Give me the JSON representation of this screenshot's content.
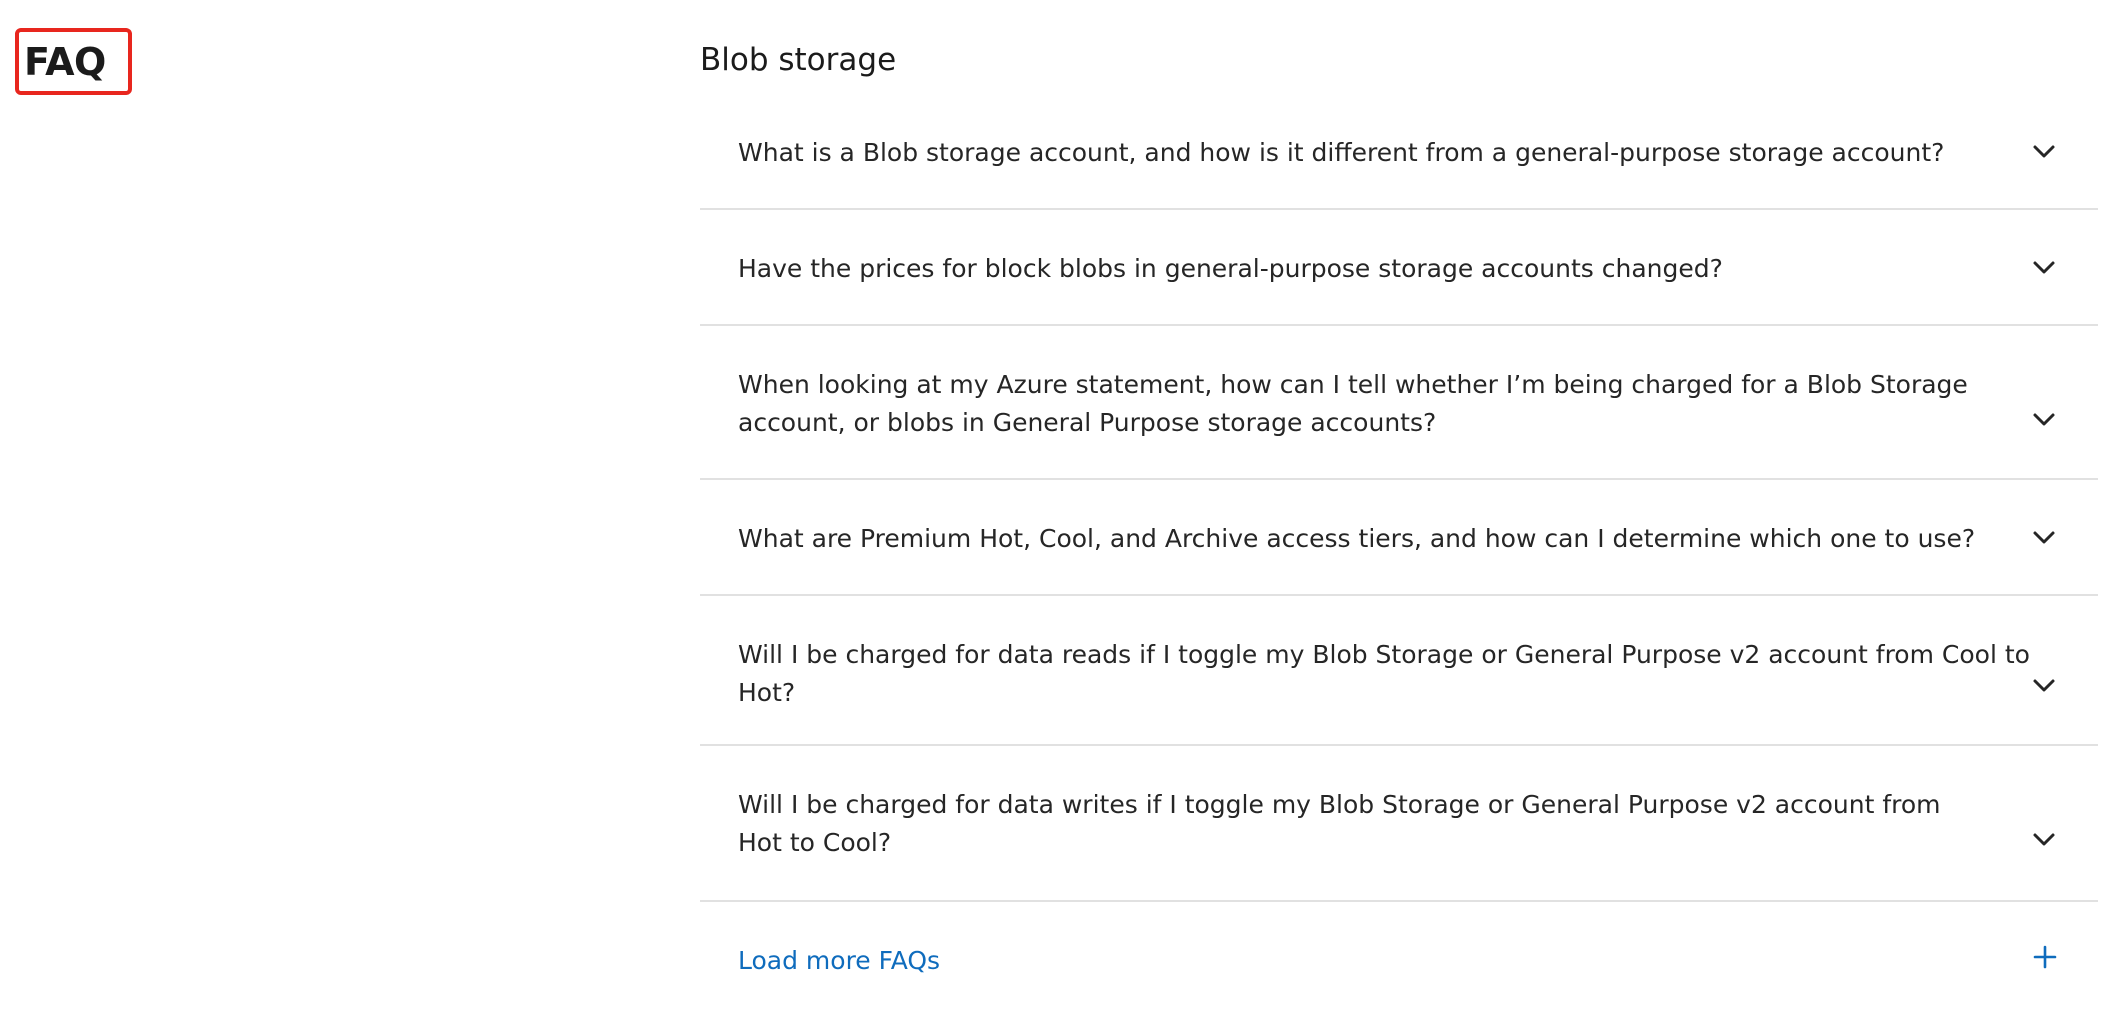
{
  "page": {
    "heading": "FAQ",
    "highlight_color": "#e8261e"
  },
  "section": {
    "title": "Blob storage"
  },
  "faqs": [
    {
      "question": "What is a Blob storage account, and how is it different from a general-purpose storage account?",
      "icon": "chevron-down-icon"
    },
    {
      "question": "Have the prices for block blobs in general-purpose storage accounts changed?",
      "icon": "chevron-down-icon"
    },
    {
      "question": "When looking at my Azure statement, how can I tell whether I’m being charged for a Blob Storage account, or blobs in General Purpose storage accounts?",
      "icon": "chevron-down-icon"
    },
    {
      "question": "What are Premium Hot, Cool, and Archive access tiers, and how can I determine which one to use?",
      "icon": "chevron-down-icon"
    },
    {
      "question": "Will I be charged for data reads if I toggle my Blob Storage or General Purpose v2 account from Cool to Hot?",
      "icon": "chevron-down-icon"
    },
    {
      "question": "Will I be charged for data writes if I toggle my Blob Storage or General Purpose v2 account from Hot to Cool?",
      "icon": "chevron-down-icon"
    }
  ],
  "load_more": {
    "label": "Load more FAQs",
    "icon": "plus-icon",
    "color": "#0f6cbd"
  }
}
